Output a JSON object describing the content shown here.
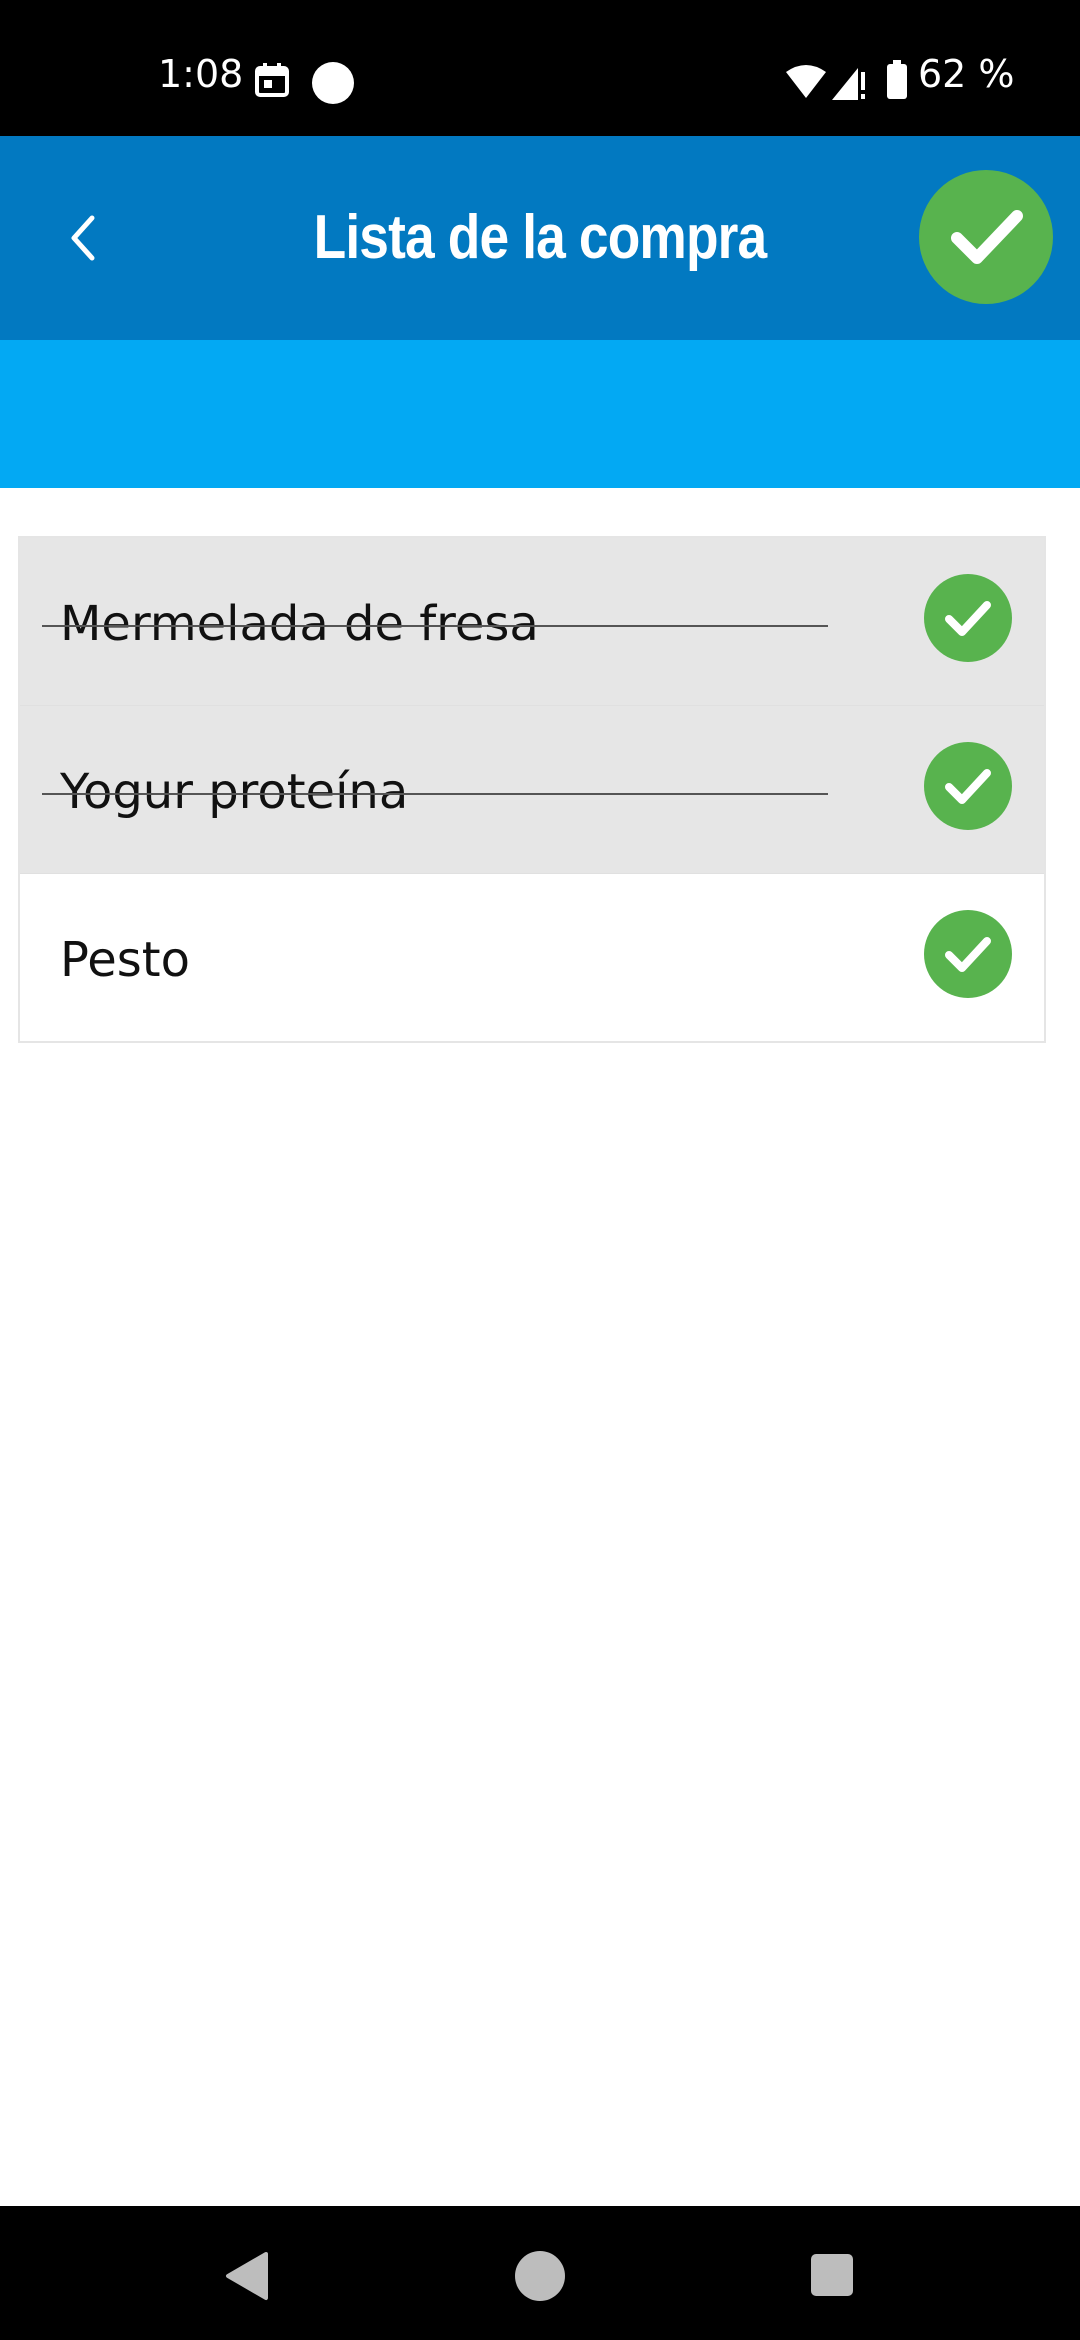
{
  "status_bar": {
    "time": "1:08",
    "battery_percent": "62 %",
    "icons": [
      "calendar-icon",
      "circle-notification-icon",
      "wifi-icon",
      "cell-signal-icon",
      "battery-icon"
    ]
  },
  "app_bar": {
    "title": "Lista de la compra",
    "back_icon": "chevron-left-icon",
    "confirm_icon": "check-icon",
    "colors": {
      "bar": "#0279C1",
      "band": "#03A9F3",
      "accent_green": "#58B34E"
    }
  },
  "list": {
    "items": [
      {
        "label": "Mermelada de fresa",
        "done": true
      },
      {
        "label": "Yogur proteína",
        "done": true
      },
      {
        "label": "Pesto",
        "done": false
      }
    ]
  },
  "nav_bar": {
    "icons": [
      "nav-back-icon",
      "nav-home-icon",
      "nav-recents-icon"
    ]
  }
}
